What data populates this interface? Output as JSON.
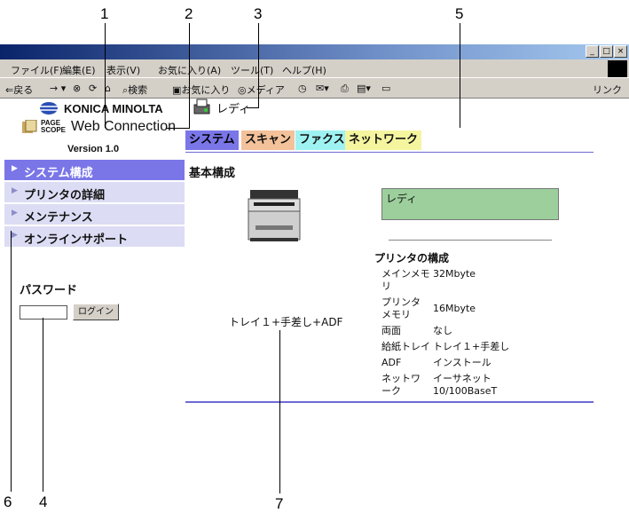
{
  "browser": {
    "menu": [
      "ファイル(F)",
      "編集(E)",
      "表示(V)",
      "お気に入り(A)",
      "ツール(T)",
      "ヘルプ(H)"
    ],
    "toolbar": {
      "back": "⇐戻る",
      "search": "検索",
      "favorites": "お気に入り",
      "media": "メディア",
      "links": "リンク"
    },
    "window_buttons": [
      "_",
      "□",
      "×"
    ]
  },
  "brand": {
    "company": "KONICA MINOLTA",
    "product_badge": "PAGE SCOPE",
    "product": "Web Connection",
    "version": "Version 1.0"
  },
  "status": {
    "text": "レディ"
  },
  "tabs": [
    {
      "label": "システム",
      "color": "#7a76e8"
    },
    {
      "label": "スキャン",
      "color": "#f3c19a"
    },
    {
      "label": "ファクス",
      "color": "#9ff2f2"
    },
    {
      "label": "ネットワーク",
      "color": "#f5f5a0"
    }
  ],
  "sidebar": {
    "items": [
      {
        "label": "システム構成",
        "selected": true
      },
      {
        "label": "プリンタの詳細",
        "selected": false
      },
      {
        "label": "メンテナンス",
        "selected": false
      },
      {
        "label": "オンラインサポート",
        "selected": false
      }
    ],
    "password_label": "パスワード",
    "password_value": "",
    "login_button": "ログイン"
  },
  "main": {
    "section_title": "基本構成",
    "status_box_text": "レディ",
    "printer_config_title": "プリンタの構成",
    "paper_source": "トレイ１+手差し+ADF",
    "specs": [
      {
        "label": "メインメモリ",
        "value": "32Mbyte"
      },
      {
        "label": "プリンタメモリ",
        "value": "16Mbyte"
      },
      {
        "label": "両面",
        "value": "なし"
      },
      {
        "label": "給紙トレイ",
        "value": "トレイ１+手差し"
      },
      {
        "label": "ADF",
        "value": "インストール"
      },
      {
        "label": "ネットワーク",
        "value": "イーサネット 10/100BaseT"
      }
    ]
  },
  "callouts": [
    "1",
    "2",
    "3",
    "4",
    "5",
    "6",
    "7"
  ],
  "colors": {
    "status_green": "#9ccf9c",
    "nav_selected": "#7a76e8",
    "nav_bg": "#dcdcf4",
    "rule_blue": "#6d6ad6"
  }
}
